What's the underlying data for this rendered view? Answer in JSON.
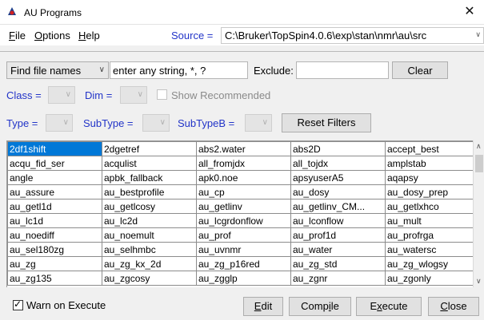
{
  "window": {
    "title": "AU Programs",
    "close_glyph": "✕",
    "icon": "duke-app-icon"
  },
  "menu": [
    {
      "mnemonic": "F",
      "rest": "ile"
    },
    {
      "mnemonic": "O",
      "rest": "ptions"
    },
    {
      "mnemonic": "H",
      "rest": "elp"
    }
  ],
  "source": {
    "label": "Source =",
    "value": "C:\\Bruker\\TopSpin4.0.6\\exp\\stan\\nmr\\au\\src"
  },
  "search": {
    "mode": "Find file names",
    "placeholder": "enter any string, *, ?",
    "exclude_label": "Exclude:",
    "exclude_value": "",
    "clear_label": "Clear"
  },
  "filters": {
    "class_label": "Class =",
    "dim_label": "Dim =",
    "show_recommended": "Show Recommended",
    "type_label": "Type =",
    "subtype_label": "SubType =",
    "subtypeb_label": "SubTypeB =",
    "reset_label": "Reset Filters"
  },
  "grid": {
    "selected": "2df1shift",
    "rows": [
      [
        "2df1shift",
        "2dgetref",
        "abs2.water",
        "abs2D",
        "accept_best"
      ],
      [
        "acqu_fid_ser",
        "acqulist",
        "all_fromjdx",
        "all_tojdx",
        "amplstab"
      ],
      [
        "angle",
        "apbk_fallback",
        "apk0.noe",
        "apsyuserA5",
        "aqapsy"
      ],
      [
        "au_assure",
        "au_bestprofile",
        "au_cp",
        "au_dosy",
        "au_dosy_prep"
      ],
      [
        "au_getl1d",
        "au_getlcosy",
        "au_getlinv",
        "au_getlinv_CM...",
        "au_getlxhco"
      ],
      [
        "au_lc1d",
        "au_lc2d",
        "au_lcgrdonflow",
        "au_lconflow",
        "au_mult"
      ],
      [
        "au_noediff",
        "au_noemult",
        "au_prof",
        "au_prof1d",
        "au_profrga"
      ],
      [
        "au_sel180zg",
        "au_selhmbc",
        "au_uvnmr",
        "au_water",
        "au_watersc"
      ],
      [
        "au_zg",
        "au_zg_kx_2d",
        "au_zg_p16red",
        "au_zg_std",
        "au_zg_wlogsy"
      ],
      [
        "au_zg135",
        "au_zgcosy",
        "au_zgglp",
        "au_zgnr",
        "au_zgonly"
      ]
    ]
  },
  "footer": {
    "warn_label": "Warn on Execute",
    "warn_checked": true,
    "edit": {
      "mnemonic": "E",
      "rest": "dit"
    },
    "compile": {
      "pre": "Comp",
      "mnemonic": "i",
      "post": "le"
    },
    "execute": {
      "pre": "E",
      "mnemonic": "x",
      "post": "ecute"
    },
    "close": {
      "mnemonic": "C",
      "rest": "lose"
    }
  }
}
